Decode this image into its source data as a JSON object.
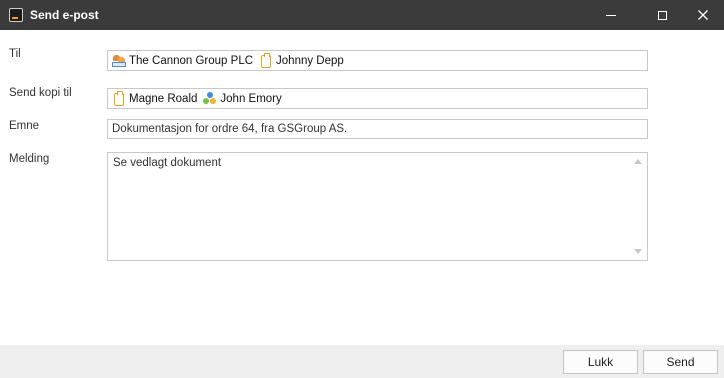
{
  "window": {
    "title": "Send e-post",
    "icon": "app-icon",
    "controls": [
      "minimize-icon",
      "maximize-icon",
      "close-icon"
    ]
  },
  "form": {
    "to_label": "Til",
    "cc_label": "Send kopi til",
    "subject_label": "Emne",
    "message_label": "Melding",
    "to_recipients": [
      {
        "name": "The Cannon Group PLC",
        "icon": "organization-icon"
      },
      {
        "name": "Johnny Depp",
        "icon": "contact-clipboard-icon"
      }
    ],
    "cc_recipients": [
      {
        "name": "Magne Roald",
        "icon": "contact-clipboard-icon"
      },
      {
        "name": "John Emory",
        "icon": "group-icon"
      }
    ],
    "subject_value": "Dokumentasjon for ordre 64, fra GSGroup AS.",
    "message_value": "Se vedlagt dokument"
  },
  "footer": {
    "close_label": "Lukk",
    "send_label": "Send"
  },
  "colors": {
    "titlebar": "#3b3b3b",
    "footer": "#efefef",
    "accent_orange": "#e8a21f",
    "border": "#c8c8c8"
  }
}
